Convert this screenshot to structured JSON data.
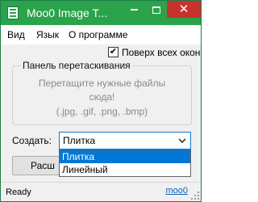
{
  "window": {
    "title": "Moo0 Image T...",
    "controls": {
      "minimize": "",
      "maximize": "",
      "close": "✕"
    },
    "colors": {
      "titlebar": "#2aa34b",
      "close": "#c7332b",
      "selection": "#0078d7",
      "link": "#0b5fc0"
    }
  },
  "menu": {
    "items": [
      "Вид",
      "Язык",
      "О программе"
    ]
  },
  "options": {
    "always_on_top_label": "Поверх всех окон",
    "always_on_top_checked": true,
    "check_glyph": "✔"
  },
  "dropzone": {
    "title": "Панель перетаскивания",
    "line1": "Перетащите нужные файлы",
    "line2": "сюда!",
    "line3": "(.jpg, .gif, .png, .bmp)"
  },
  "create": {
    "label": "Создать:",
    "selected": "Плитка",
    "options": [
      "Плитка",
      "Линейный"
    ],
    "highlighted_index": 0
  },
  "action_button": {
    "visible_label": "Расш"
  },
  "status": {
    "text": "Ready",
    "link": "moo0"
  }
}
